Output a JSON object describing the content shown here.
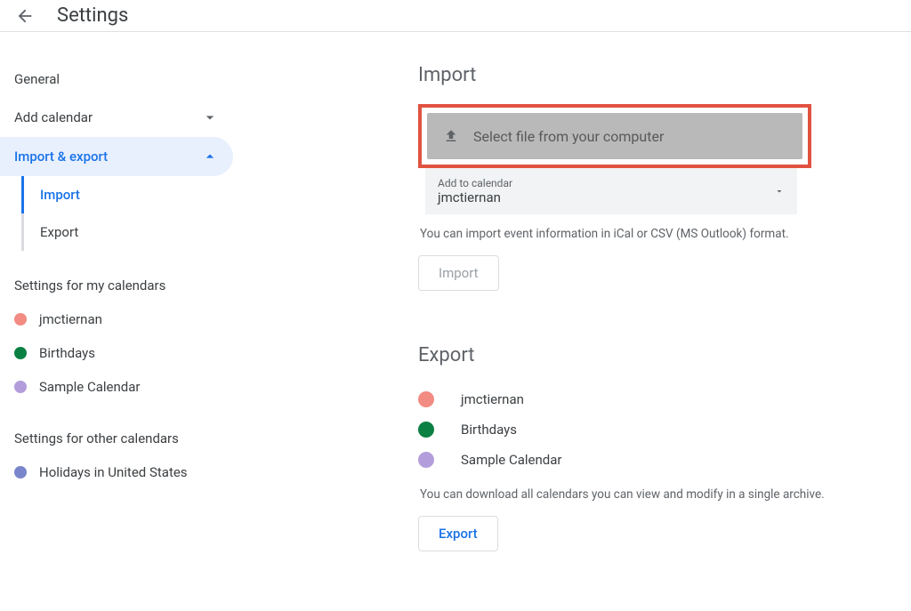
{
  "header": {
    "title": "Settings"
  },
  "sidebar": {
    "general": "General",
    "addCalendar": "Add calendar",
    "importExport": "Import & export",
    "sub": {
      "import": "Import",
      "export": "Export"
    },
    "myCalSection": "Settings for my calendars",
    "myCals": [
      {
        "label": "jmctiernan",
        "color": "#f28b82"
      },
      {
        "label": "Birthdays",
        "color": "#0b8043"
      },
      {
        "label": "Sample Calendar",
        "color": "#b39ddb"
      }
    ],
    "otherCalSection": "Settings for other calendars",
    "otherCals": [
      {
        "label": "Holidays in United States",
        "color": "#7986cb"
      }
    ]
  },
  "main": {
    "import": {
      "title": "Import",
      "selectFile": "Select file from your computer",
      "addToLabel": "Add to calendar",
      "addToValue": "jmctiernan",
      "helper": "You can import event information in iCal or CSV (MS Outlook) format.",
      "button": "Import"
    },
    "export": {
      "title": "Export",
      "cals": [
        {
          "label": "jmctiernan",
          "color": "#f28b82"
        },
        {
          "label": "Birthdays",
          "color": "#0b8043"
        },
        {
          "label": "Sample Calendar",
          "color": "#b39ddb"
        }
      ],
      "helper": "You can download all calendars you can view and modify in a single archive.",
      "button": "Export"
    }
  }
}
